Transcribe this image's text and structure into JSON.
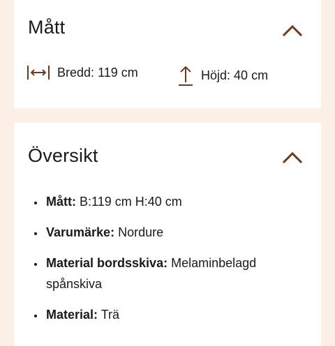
{
  "colors": {
    "page_background": "#fcefe6",
    "card_background": "#ffffff",
    "accent": "#6b3a1f",
    "text": "#1a1a1a"
  },
  "dimensions_section": {
    "title": "Mått",
    "toggle_icon": "chevron-up-icon",
    "width": {
      "icon": "width-arrows-icon",
      "label": "Bredd:",
      "value": "119 cm"
    },
    "height": {
      "icon": "height-arrow-icon",
      "label": "Höjd:",
      "value": "40 cm"
    }
  },
  "overview_section": {
    "title": "Översikt",
    "toggle_icon": "chevron-up-icon",
    "items": [
      {
        "label": "Mått:",
        "value": "B:119 cm H:40 cm"
      },
      {
        "label": "Varumärke:",
        "value": "Nordure"
      },
      {
        "label": "Material bordsskiva:",
        "value": "Melaminbelagd spånskiva"
      },
      {
        "label": "Material:",
        "value": "Trä"
      }
    ]
  }
}
